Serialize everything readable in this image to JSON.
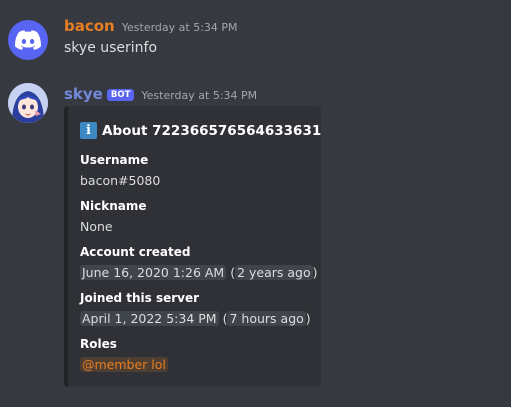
{
  "messages": [
    {
      "avatar_icon": "discord-logo-icon",
      "username": "bacon",
      "username_color": "#e67e22",
      "timestamp": "Yesterday at 5:34 PM",
      "text": "skye userinfo"
    },
    {
      "avatar_icon": "anime-avatar-icon",
      "username": "skye",
      "username_color": "#7289da",
      "bot_tag": "BOT",
      "timestamp": "Yesterday at 5:34 PM",
      "embed": {
        "title_icon": "info-icon",
        "title_icon_glyph": "i",
        "title": "About 722366576564633631",
        "fields": {
          "username": {
            "name": "Username",
            "value": "bacon#5080"
          },
          "nickname": {
            "name": "Nickname",
            "value": "None"
          },
          "account_created": {
            "name": "Account created",
            "date": "June 16, 2020 1:26 AM",
            "relative": "2 years ago"
          },
          "joined_server": {
            "name": "Joined this server",
            "date": "April 1, 2022 5:34 PM",
            "relative": "7 hours ago"
          },
          "roles": {
            "name": "Roles",
            "value": "@member lol"
          }
        }
      }
    }
  ],
  "colors": {
    "background": "#36393f",
    "embed_background": "#2f3136",
    "blurple": "#5865f2",
    "role_color": "#e67e22"
  }
}
